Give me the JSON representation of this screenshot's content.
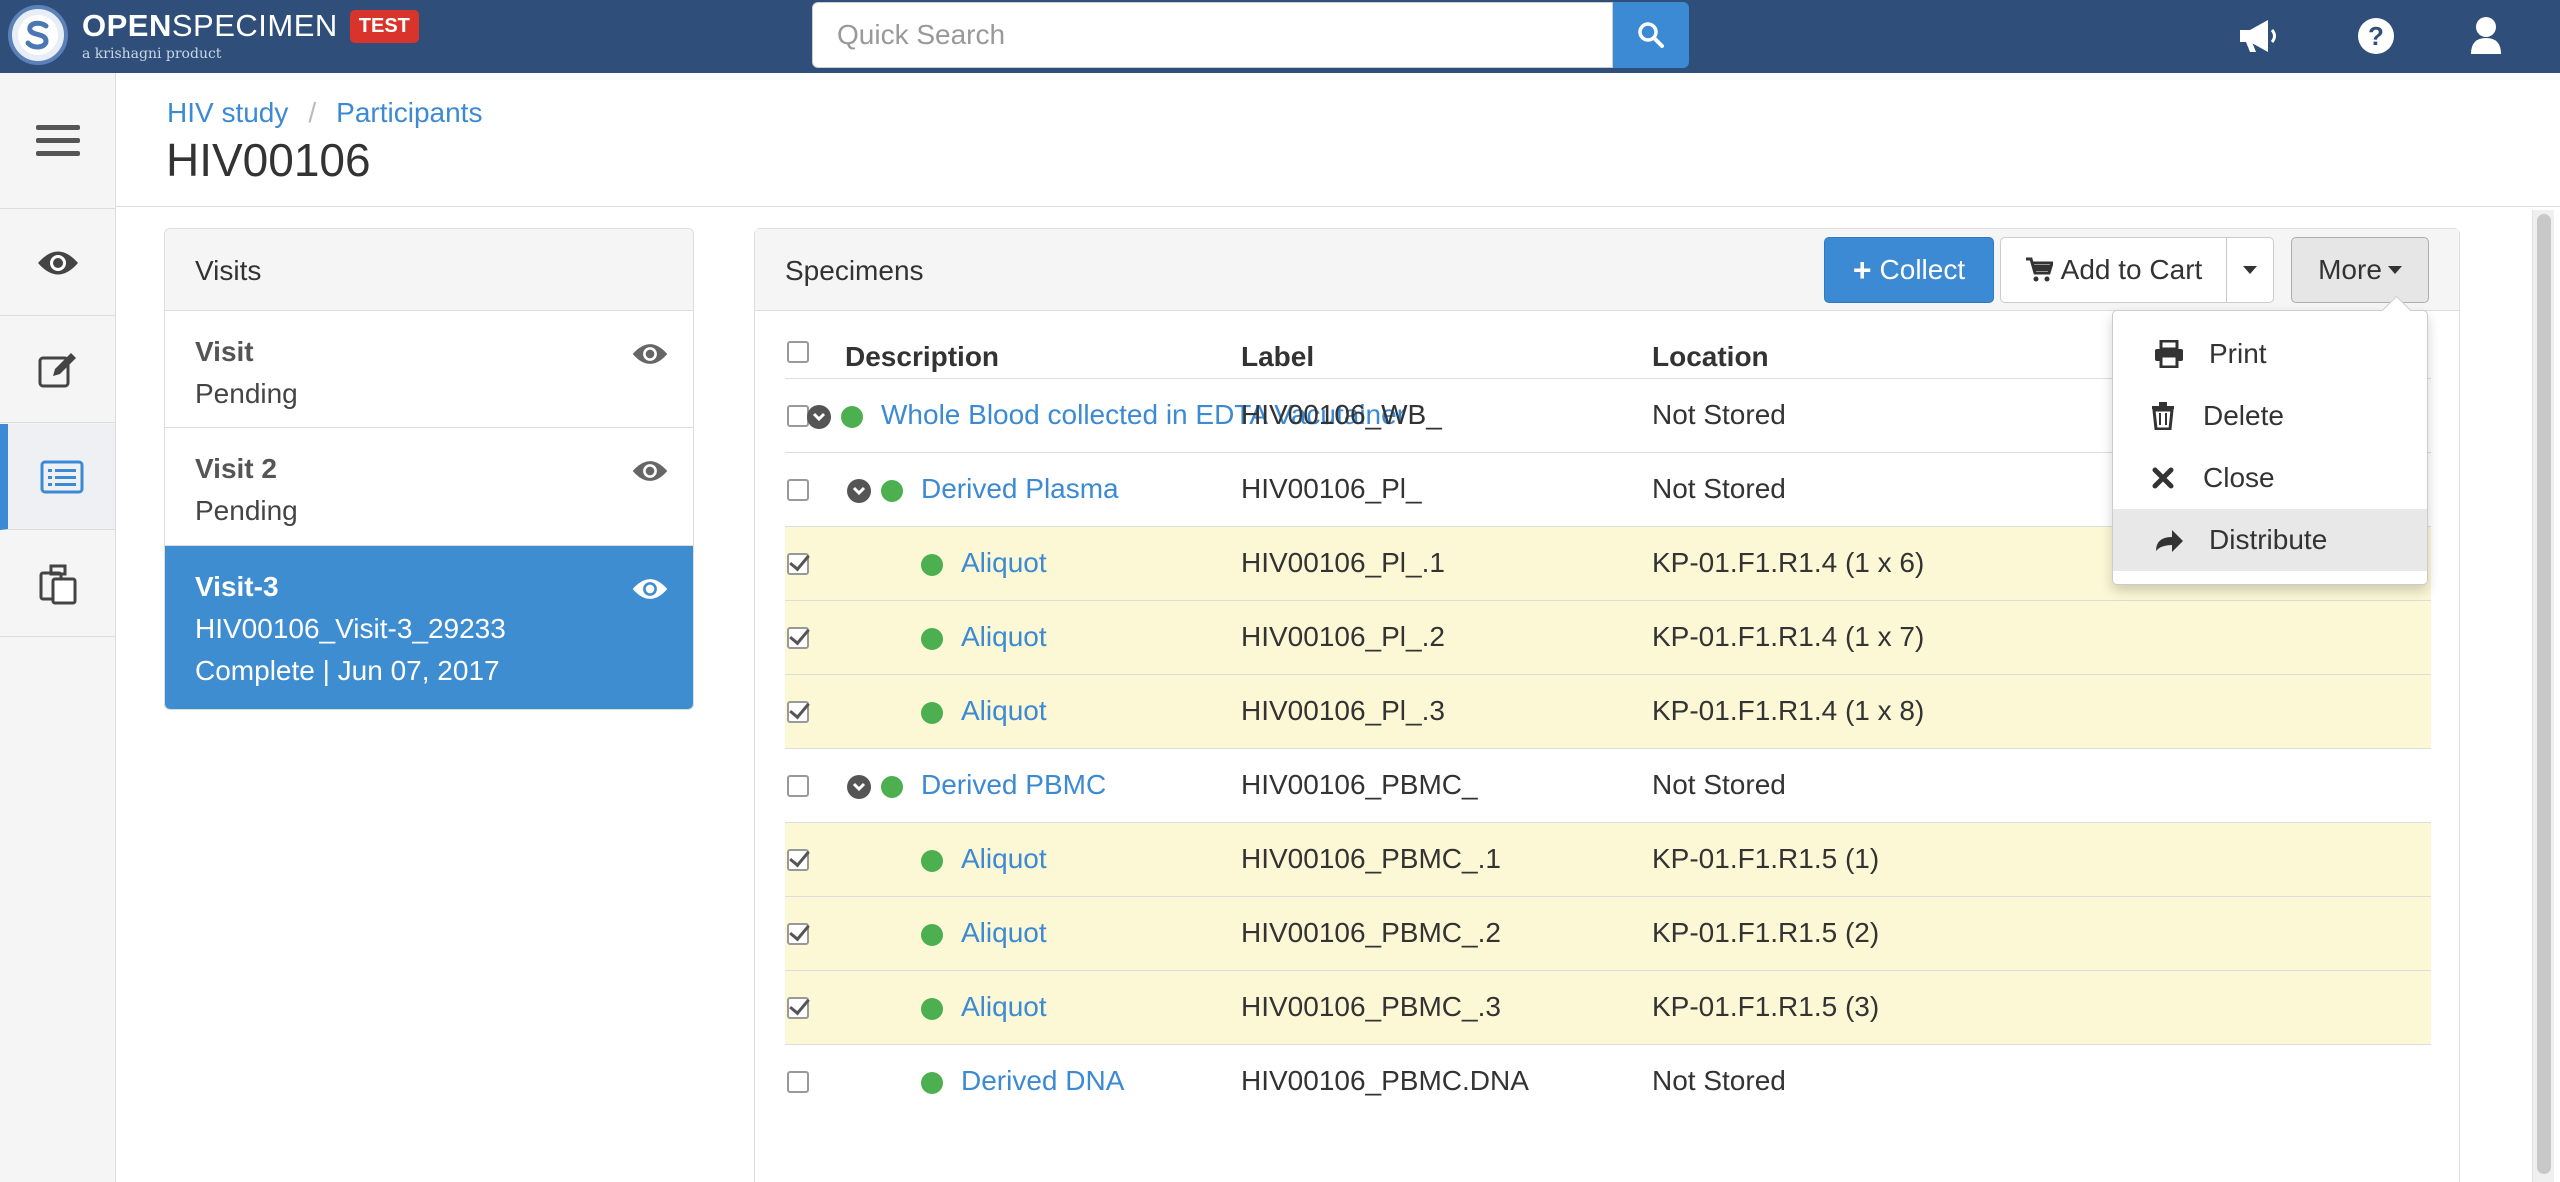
{
  "brand": {
    "name_bold": "OPEN",
    "name_rest": "SPECIMEN",
    "tagline": "a krishagni product",
    "env_badge": "TEST"
  },
  "search": {
    "placeholder": "Quick Search"
  },
  "topnav": {
    "icons": [
      "megaphone-icon",
      "help-icon",
      "user-icon"
    ]
  },
  "sidebar": {
    "items": [
      "menu-icon",
      "eye-icon",
      "edit-icon",
      "list-icon",
      "copy-icon"
    ],
    "active_index": 3
  },
  "breadcrumb": {
    "study": "HIV study",
    "separator": "/",
    "section": "Participants"
  },
  "page": {
    "title": "HIV00106"
  },
  "visits": {
    "title": "Visits",
    "items": [
      {
        "name": "Visit",
        "line2": "Pending",
        "line3": ""
      },
      {
        "name": "Visit 2",
        "line2": "Pending",
        "line3": ""
      },
      {
        "name": "Visit-3",
        "line2": "HIV00106_Visit-3_29233",
        "line3": "Complete | Jun 07, 2017"
      }
    ]
  },
  "specimens": {
    "title": "Specimens",
    "buttons": {
      "collect": "Collect",
      "add_to_cart": "Add to Cart",
      "more": "More"
    },
    "columns": {
      "description": "Description",
      "label": "Label",
      "location": "Location"
    },
    "rows": [
      {
        "description": "Whole Blood collected in EDTA Vacutainer",
        "label": "HIV00106_WB_",
        "location": "Not Stored",
        "checked": false,
        "level": 0,
        "expand": true
      },
      {
        "description": "Derived Plasma",
        "label": "HIV00106_Pl_",
        "location": "Not Stored",
        "checked": false,
        "level": 1,
        "expand": true
      },
      {
        "description": "Aliquot",
        "label": "HIV00106_Pl_.1",
        "location": "KP-01.F1.R1.4 (1 x 6)",
        "checked": true,
        "level": 2,
        "expand": false
      },
      {
        "description": "Aliquot",
        "label": "HIV00106_Pl_.2",
        "location": "KP-01.F1.R1.4 (1 x 7)",
        "checked": true,
        "level": 2,
        "expand": false
      },
      {
        "description": "Aliquot",
        "label": "HIV00106_Pl_.3",
        "location": "KP-01.F1.R1.4 (1 x 8)",
        "checked": true,
        "level": 2,
        "expand": false
      },
      {
        "description": "Derived PBMC",
        "label": "HIV00106_PBMC_",
        "location": "Not Stored",
        "checked": false,
        "level": 1,
        "expand": true
      },
      {
        "description": "Aliquot",
        "label": "HIV00106_PBMC_.1",
        "location": "KP-01.F1.R1.5 (1)",
        "checked": true,
        "level": 2,
        "expand": false
      },
      {
        "description": "Aliquot",
        "label": "HIV00106_PBMC_.2",
        "location": "KP-01.F1.R1.5 (2)",
        "checked": true,
        "level": 2,
        "expand": false
      },
      {
        "description": "Aliquot",
        "label": "HIV00106_PBMC_.3",
        "location": "KP-01.F1.R1.5 (3)",
        "checked": true,
        "level": 2,
        "expand": false
      },
      {
        "description": "Derived DNA",
        "label": "HIV00106_PBMC.DNA",
        "location": "Not Stored",
        "checked": false,
        "level": 2,
        "expand": false
      }
    ]
  },
  "more_menu": {
    "items": [
      {
        "label": "Print",
        "icon": "print-icon"
      },
      {
        "label": "Delete",
        "icon": "trash-icon"
      },
      {
        "label": "Close",
        "icon": "close-icon"
      },
      {
        "label": "Distribute",
        "icon": "share-icon"
      }
    ],
    "highlighted_index": 3
  },
  "colors": {
    "navbar": "#2f4e79",
    "primary": "#3b8ad3",
    "selected_row": "#fcf8d5",
    "status_dot": "#4caf50",
    "badge": "#d9342b"
  }
}
